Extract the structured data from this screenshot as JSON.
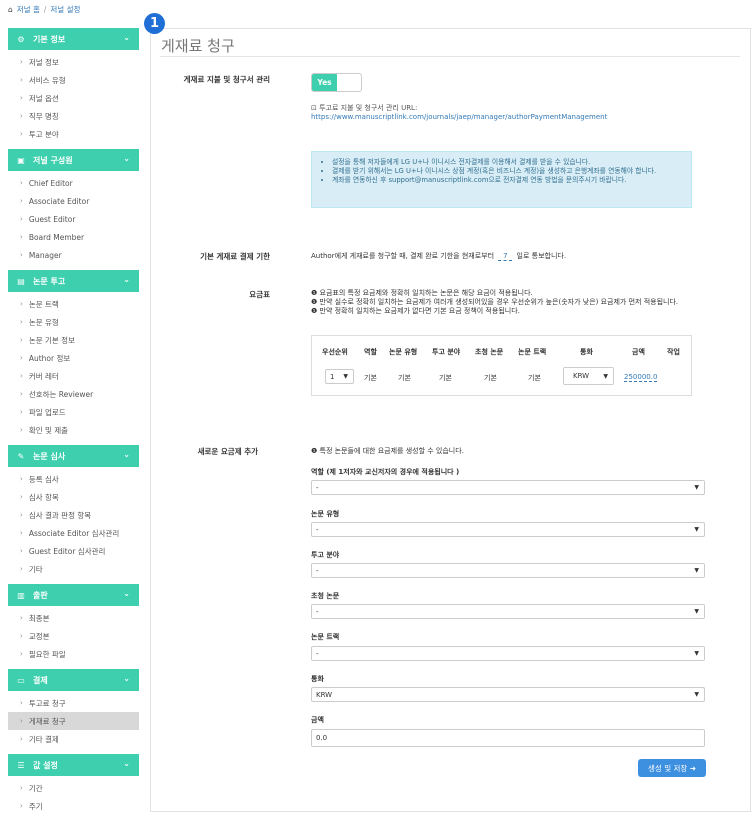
{
  "breadcrumb": {
    "home": "저널 홈",
    "sep": "/",
    "current": "저널 설정"
  },
  "badge": "1",
  "sidebar": [
    {
      "title": "기본 정보",
      "icon": "gear-icon",
      "items": [
        "저널 정보",
        "서비스 유형",
        "저널 옵션",
        "직무 명칭",
        "투고 분야"
      ]
    },
    {
      "title": "저널 구성원",
      "icon": "briefcase-icon",
      "items": [
        "Chief Editor",
        "Associate Editor",
        "Guest Editor",
        "Board Member",
        "Manager"
      ]
    },
    {
      "title": "논문 투고",
      "icon": "document-icon",
      "items": [
        "논문 트랙",
        "논문 유형",
        "논문 기본 정보",
        "Author 정보",
        "커버 레터",
        "선호하는 Reviewer",
        "파일 업로드",
        "확인 및 제출"
      ]
    },
    {
      "title": "논문 심사",
      "icon": "edit-icon",
      "items": [
        "등록 심사",
        "심사 항목",
        "심사 결과 판정 항목",
        "Associate Editor 심사관리",
        "Guest Editor 심사관리",
        "기타"
      ]
    },
    {
      "title": "출판",
      "icon": "book-icon",
      "items": [
        "최종본",
        "교정본",
        "필요한 파일"
      ]
    },
    {
      "title": "결제",
      "icon": "money-icon",
      "items": [
        "투고료 청구",
        "게재료 청구",
        "기타 결제"
      ],
      "active": 1
    },
    {
      "title": "값 설정",
      "icon": "sliders-icon",
      "items": [
        "기간",
        "주기"
      ]
    }
  ],
  "page": {
    "title": "게재료 청구",
    "manage_label": "게재료 지불 및 청구서 관리",
    "toggle_label": "Yes",
    "url_caption": "투고료 지불 및 청구서 관리 URL:",
    "url": "https://www.manuscriptlink.com/journals/jaep/manager/authorPaymentManagement",
    "info": [
      "설정을 통해 저자들에게 LG U+나 이니시스 전자결제를 이용해서 결제를 받을 수 있습니다.",
      "결제를 받기 위해서는 LG U+나 이니시스 상점 계정(혹은 비즈니스 계정)을 생성하고 은행계좌를 연동해야 합니다.",
      "계좌를 연동하신 후 support@manuscriptlink.com으로 전자결제 연동 방법을 문의주시기 바랍니다."
    ],
    "deadline_label": "기본 게재료 결제 기한",
    "deadline_pre": "Author에게 게재료를 청구할 때, 결제 완료 기한을 현재로부터",
    "deadline_value": "7",
    "deadline_post": "일로 통보합니다.",
    "fee_label": "요금표",
    "fee_notes": [
      "요금표의 특정 요금제와 정확히 일치하는 논문은 해당 요금이 적용됩니다.",
      "만약 실수로 정확히 일치하는 요금제가 여러개 생성되어있을 경우 우선순위가 높은(숫자가 낮은) 요금제가 먼저 적용됩니다.",
      "만약 정확히 일치하는 요금제가 없다면 기본 요금 정책이 적용됩니다."
    ],
    "table": {
      "headers": [
        "우선순위",
        "역할",
        "논문 유형",
        "투고 분야",
        "초청 논문",
        "논문 트랙",
        "통화",
        "금액",
        "작업"
      ],
      "row": {
        "priority": "1",
        "role": "기본",
        "type": "기본",
        "field": "기본",
        "invited": "기본",
        "track": "기본",
        "currency": "KRW",
        "amount": "250000.0"
      }
    },
    "new_label": "새로운 요금제 추가",
    "new_note": "특정 논문들에 대한 요금제를 생성할 수 있습니다.",
    "form": [
      {
        "label": "역할 (제 1저자와 교신저자의 경우에 적용됩니다 )",
        "value": "-"
      },
      {
        "label": "논문 유형",
        "value": "-"
      },
      {
        "label": "투고 분야",
        "value": "-"
      },
      {
        "label": "초청 논문",
        "value": "-"
      },
      {
        "label": "논문 트랙",
        "value": "-"
      },
      {
        "label": "통화",
        "value": "KRW"
      },
      {
        "label": "금액",
        "value": "0.0"
      }
    ],
    "submit": "생성 및 저장"
  },
  "colors": {
    "accent": "#3ecfae",
    "link": "#337ab7",
    "button": "#3d8fe0",
    "info_bg": "#d9edf7"
  }
}
